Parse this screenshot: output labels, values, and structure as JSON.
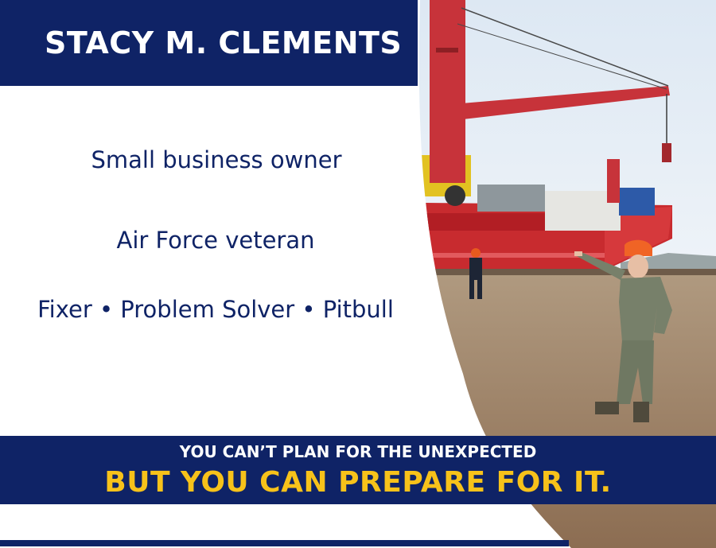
{
  "header": {
    "name": "STACY M. CLEMENTS"
  },
  "bio": {
    "line1": "Small business owner",
    "line2": "Air Force veteran",
    "line3": "Fixer • Problem Solver • Pitbull"
  },
  "tagline": {
    "line1": "YOU CAN’T PLAN FOR THE UNEXPECTED",
    "line2": "BUT YOU CAN PREPARE FOR IT."
  },
  "colors": {
    "navy": "#0f2366",
    "gold": "#f7c21a",
    "white": "#ffffff"
  },
  "photo": {
    "subject": "service member in camouflage uniform and orange hard hat pointing, with a person in dark coveralls, beside a red cargo ship with a crane on a dirt pier"
  }
}
